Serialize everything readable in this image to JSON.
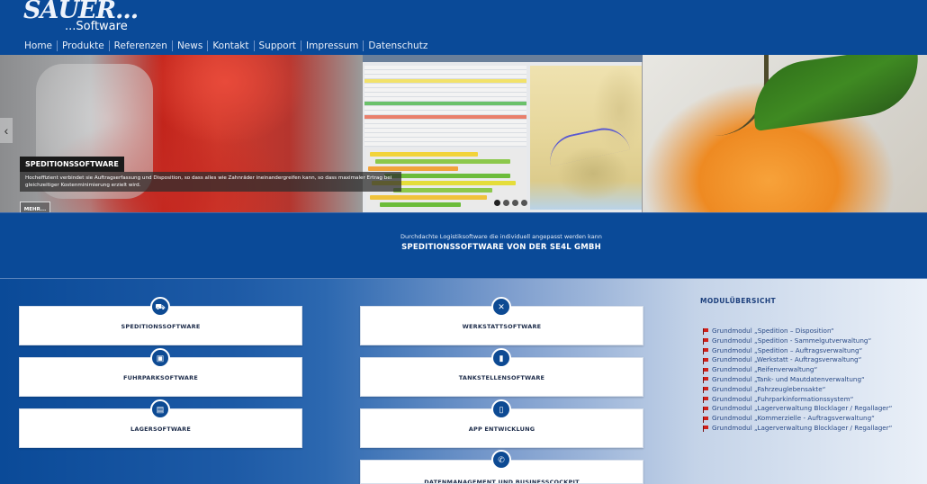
{
  "header": {
    "logo_main": "SAUER...",
    "logo_sub": "...Software",
    "nav": [
      "Home",
      "Produkte",
      "Referenzen",
      "News",
      "Kontakt",
      "Support",
      "Impressum",
      "Datenschutz"
    ]
  },
  "hero": {
    "caption_title": "SPEDITIONSSOFTWARE",
    "caption_text": "Hocheffizient verbindet sie Auftragserfassung und Disposition, so dass alles wie Zahnräder ineinandergreifen kann, so dass maximaler Ertrag bei gleichzeitiger Kostenminimierung erzielt wird.",
    "more_label": "MEHR...",
    "slide_count": 4,
    "active_slide": 1
  },
  "intro": {
    "subtitle": "Durchdachte Logistiksoftware die individuell angepasst werden kann",
    "title": "SPEDITIONSSOFTWARE VON DER SE4L GMBH"
  },
  "cards": [
    {
      "label": "SPEDITIONSSOFTWARE",
      "icon": "truck-icon"
    },
    {
      "label": "WERKSTATTSOFTWARE",
      "icon": "tools-icon"
    },
    {
      "label": "FUHRPARKSOFTWARE",
      "icon": "bus-icon"
    },
    {
      "label": "TANKSTELLENSOFTWARE",
      "icon": "fuel-icon"
    },
    {
      "label": "LAGERSOFTWARE",
      "icon": "box-icon"
    },
    {
      "label": "APP ENTWICKLUNG",
      "icon": "mobile-icon"
    },
    {
      "label": "DATENMANAGEMENT UND BUSINESSCOCKPIT",
      "icon": "phone-icon"
    }
  ],
  "modules": {
    "title": "MODULÜBERSICHT",
    "items": [
      "Grundmodul „Spedition – Disposition“",
      "Grundmodul „Spedition - Sammelgutverwaltung“",
      "Grundmodul „Spedition – Auftragsverwaltung“",
      "Grundmodul „Werkstatt - Auftragsverwaltung“",
      "Grundmodul „Reifenverwaltung“",
      "Grundmodul „Tank- und Mautdatenverwaltung“",
      "Grundmodul „Fahrzeuglebensakte“",
      "Grundmodul „Fuhrparkinformationssystem“",
      "Grundmodul „Lagerverwaltung Blocklager / Regallager“",
      "Grundmodul „Kommerzielle - Auftragsverwaltung“",
      "Grundmodul „Lagerverwaltung Blocklager / Regallager“"
    ]
  },
  "colors": {
    "brand_blue": "#0a4a98",
    "icon_blue": "#0d4a93",
    "flag_red": "#d0201a"
  }
}
